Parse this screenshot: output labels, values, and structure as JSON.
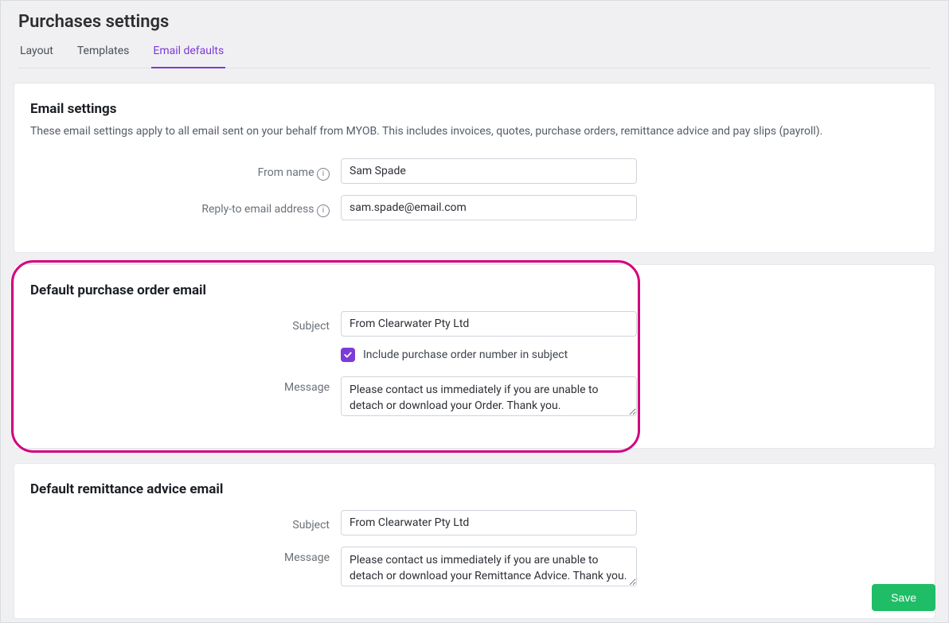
{
  "page_title": "Purchases settings",
  "tabs": [
    {
      "label": "Layout",
      "active": false
    },
    {
      "label": "Templates",
      "active": false
    },
    {
      "label": "Email defaults",
      "active": true
    }
  ],
  "email_settings": {
    "title": "Email settings",
    "description": "These email settings apply to all email sent on your behalf from MYOB. This includes invoices, quotes, purchase orders, remittance advice and pay slips (payroll).",
    "from_name_label": "From name",
    "from_name_value": "Sam Spade",
    "reply_to_label": "Reply-to email address",
    "reply_to_value": "sam.spade@email.com"
  },
  "purchase_order_email": {
    "title": "Default purchase order email",
    "subject_label": "Subject",
    "subject_value": "From Clearwater Pty Ltd",
    "include_number_checked": true,
    "include_number_label": "Include purchase order number in subject",
    "message_label": "Message",
    "message_value": "Please contact us immediately if you are unable to detach or download your Order. Thank you."
  },
  "remittance_email": {
    "title": "Default remittance advice email",
    "subject_label": "Subject",
    "subject_value": "From Clearwater Pty Ltd",
    "message_label": "Message",
    "message_value": "Please contact us immediately if you are unable to detach or download your Remittance Advice. Thank you."
  },
  "footer": {
    "save_label": "Save"
  }
}
